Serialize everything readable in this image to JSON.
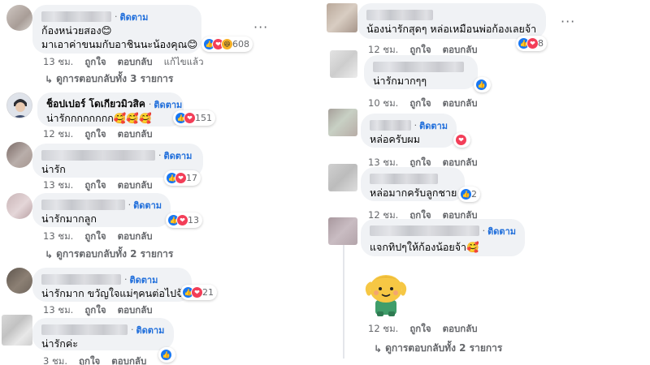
{
  "common": {
    "follow": "ติดตาม",
    "like": "ถูกใจ",
    "reply": "ตอบกลับ",
    "edited": "แก้ไขแล้ว",
    "dot": "·",
    "more": "···",
    "thumb": "👍",
    "heart": "❤",
    "haha": "😆"
  },
  "left": [
    {
      "name": "",
      "lines": [
        "ก้องหน่วยสอง😊",
        "มาเอาค่าขนมกับอาชินนะน้องคุณ😊"
      ],
      "reaction_count": "608",
      "time": "13 ชม.",
      "replies": "ดูการตอบกลับทั้ง 3 รายการ"
    },
    {
      "name": "ช็อปเปอร์ โดเกียวมิวสิค",
      "lines": [
        "น่ารักกกกกกกก🥰🥰🥰"
      ],
      "reaction_count": "151",
      "time": "12 ชม."
    },
    {
      "name": "",
      "lines": [
        "น่ารัก"
      ],
      "reaction_count": "17",
      "time": "13 ชม."
    },
    {
      "name": "",
      "lines": [
        "น่ารักมากลูก"
      ],
      "reaction_count": "13",
      "time": "13 ชม.",
      "replies": "ดูการตอบกลับทั้ง 2 รายการ"
    },
    {
      "name": "",
      "lines": [
        "น่ารักมาก ขวัญใจแม่ๆคนต่อไปจ้า"
      ],
      "reaction_count": "21",
      "time": "13 ชม."
    },
    {
      "name": "",
      "lines": [
        "น่ารักค่ะ"
      ],
      "reaction_count": "",
      "time": "3 ชม."
    }
  ],
  "right": [
    {
      "name": "",
      "lines": [
        "น้องน่ารักสุดๆ หล่อเหมือนพ่อก้องเลยจ้า"
      ],
      "reaction_count": "8",
      "time": "12 ชม."
    },
    {
      "name": "",
      "lines": [
        "น่ารักมากๆๆ"
      ],
      "reaction_count": "",
      "time": "10 ชม."
    },
    {
      "name": "",
      "lines": [
        "หล่อครับผม"
      ],
      "reaction_count": "",
      "time": "13 ชม."
    },
    {
      "name": "",
      "lines": [
        "หล่อมากครับลูกชาย"
      ],
      "reaction_count": "2",
      "time": "12 ชม."
    },
    {
      "name": "",
      "lines": [
        "แจกทิปๆให้ก้องน้อยจ้า🥰"
      ],
      "reaction_count": "",
      "time": "12 ชม.",
      "replies": "ดูการตอบกลับทั้ง 2 รายการ"
    }
  ]
}
